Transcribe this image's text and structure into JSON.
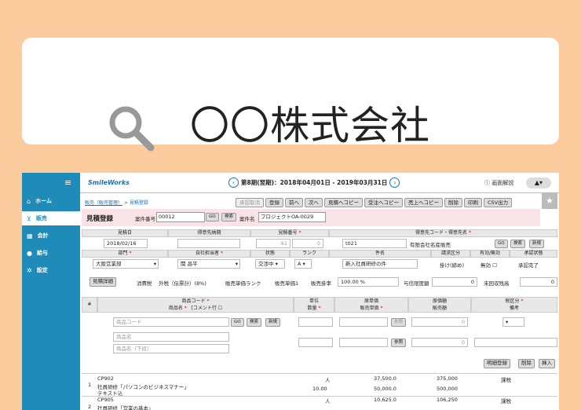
{
  "search": {
    "query": "〇〇株式会社"
  },
  "sidebar": {
    "items": [
      {
        "icon": "home-icon",
        "glyph": "⌂",
        "label": "ホーム"
      },
      {
        "icon": "cart-icon",
        "glyph": "⊻",
        "label": "販売"
      },
      {
        "icon": "calculator-icon",
        "glyph": "▦",
        "label": "会計"
      },
      {
        "icon": "money-bag-icon",
        "glyph": "●",
        "label": "給与"
      },
      {
        "icon": "gear-icon",
        "glyph": "✲",
        "label": "設定"
      }
    ]
  },
  "header": {
    "logo": "SmileWorks",
    "period": "第8期(翌期)：2018年04月01日 - 2019年03月31日",
    "help": "画面解説"
  },
  "breadcrumb": {
    "parent": "販売（販売管理）",
    "current": "見積登録"
  },
  "toolbar": [
    "承認取消",
    "登録",
    "前へ",
    "次へ",
    "見積へコピー",
    "受注へコピー",
    "売上へコピー",
    "削除",
    "印刷",
    "CSV出力"
  ],
  "form": {
    "title": "見積登録",
    "case_no_label": "案件番号",
    "case_no": "00012",
    "go": "GO",
    "search": "検索",
    "new": "新規",
    "case_name_label": "案件名",
    "case_name": "プロジェクトOA-0029",
    "headers": {
      "estimate_date": "見積日",
      "delivery_date": "得意先納期",
      "estimate_no": "見積番号",
      "customer": "得意先コード・得意先名",
      "dept": "部門",
      "staff": "自社担当者",
      "status": "状態",
      "rank": "ランク",
      "subject": "件名",
      "billing": "請求区分",
      "valid": "有効/無効",
      "approval": "承認状態"
    },
    "values": {
      "estimate_date": "2018/02/16",
      "estimate_no": "61",
      "estimate_sub": "0",
      "customer_code": "t021",
      "customer_name": "有限会社名産販売",
      "dept": "大阪営業部",
      "staff": "関 昌平",
      "status": "交渉中",
      "rank": "A",
      "subject": "新入社員研修の件",
      "billing": "掛け(締め)",
      "valid": "無効",
      "approval": "承認完了"
    }
  },
  "summary": {
    "details_btn": "見積詳細",
    "tax_label": "消費税",
    "tax_value": "外税（伝票計）(8%)",
    "rank_label": "販売単価ランク",
    "rank_value": "販売単価1",
    "rate_label": "販売掛率",
    "rate_value": "100.00 %",
    "credit_label": "与信限度額",
    "credit_value": "0",
    "unpaid_label": "未回収残高",
    "unpaid_value": "0"
  },
  "lines": {
    "headers": {
      "no": "#",
      "code": "商品コード",
      "name": "商品名",
      "comment": "[コメント行",
      "unit": "単位",
      "qty": "数量",
      "cost": "原単価",
      "price": "販売単価",
      "cost_amt": "原価額",
      "sales_amt": "販売額",
      "tax": "税区分",
      "note": "備考"
    },
    "placeholders": {
      "code": "商品コード",
      "name": "商品名",
      "name2": "商品名（下段）"
    },
    "ref": "参照",
    "zero": "0",
    "actions": [
      "明細登録",
      "削除",
      "挿入"
    ],
    "rows": [
      {
        "no": "1",
        "code": "CP902",
        "name": "社員研修「パソコンのビジネスマナー」",
        "name2": "テキスト込",
        "unit": "人",
        "qty": "10.00",
        "cost": "37,500.0",
        "price": "50,000.0",
        "cost_amt": "375,000",
        "sales_amt": "500,000",
        "tax": "課税"
      },
      {
        "no": "2",
        "code": "CP905",
        "name": "社員研修「営業の基本」",
        "unit": "人",
        "cost": "10,625.0",
        "cost_amt": "106,250",
        "tax": "課税"
      }
    ]
  }
}
